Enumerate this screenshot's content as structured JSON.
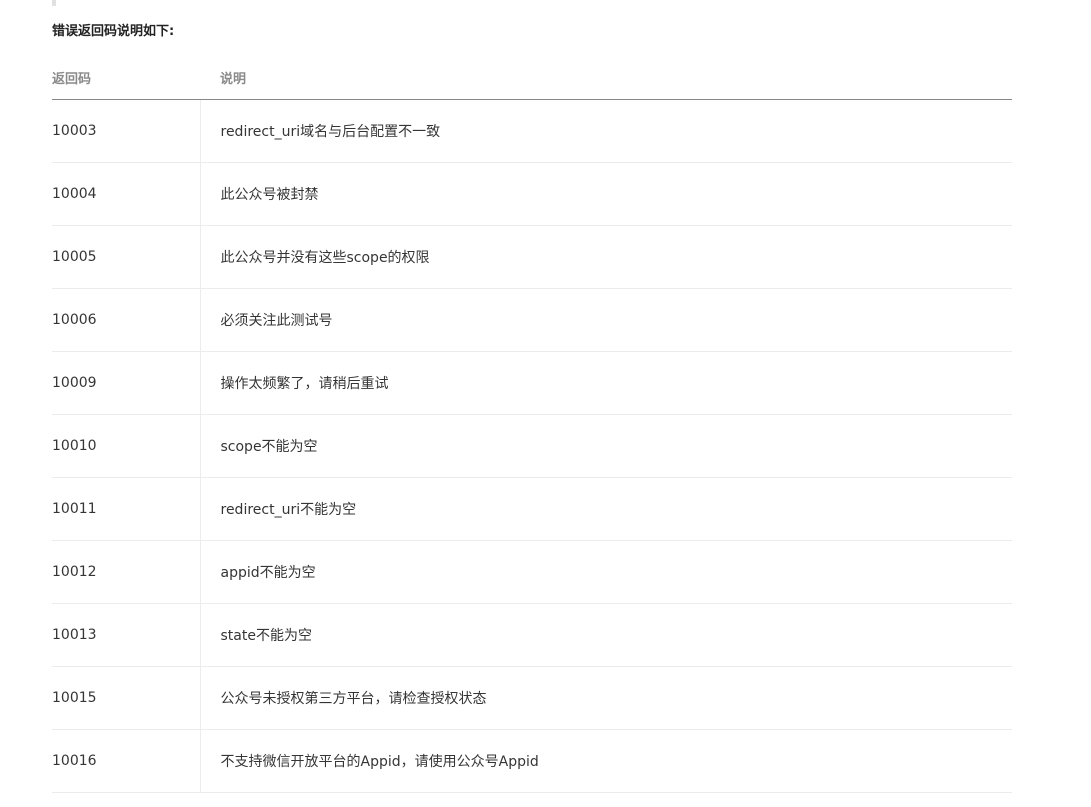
{
  "heading": "错误返回码说明如下:",
  "table": {
    "headers": {
      "code": "返回码",
      "description": "说明"
    },
    "rows": [
      {
        "code": "10003",
        "description": "redirect_uri域名与后台配置不一致"
      },
      {
        "code": "10004",
        "description": "此公众号被封禁"
      },
      {
        "code": "10005",
        "description": "此公众号并没有这些scope的权限"
      },
      {
        "code": "10006",
        "description": "必须关注此测试号"
      },
      {
        "code": "10009",
        "description": "操作太频繁了，请稍后重试"
      },
      {
        "code": "10010",
        "description": "scope不能为空"
      },
      {
        "code": "10011",
        "description": "redirect_uri不能为空"
      },
      {
        "code": "10012",
        "description": "appid不能为空"
      },
      {
        "code": "10013",
        "description": "state不能为空"
      },
      {
        "code": "10015",
        "description": "公众号未授权第三方平台，请检查授权状态"
      },
      {
        "code": "10016",
        "description": "不支持微信开放平台的Appid，请使用公众号Appid"
      }
    ]
  }
}
